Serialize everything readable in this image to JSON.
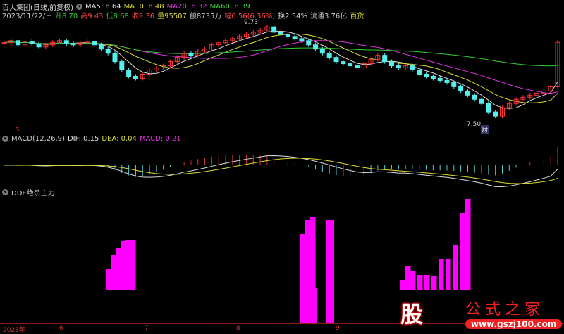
{
  "header": {
    "title": "百大集团(日线,前复权)",
    "ma5": "MA5: 8.64",
    "ma10": "MA10: 8.48",
    "ma20": "MA20: 8.32",
    "ma60": "MA60: 8.39",
    "date": "2023/11/22/三",
    "open": "开8.70",
    "high": "高9.43",
    "low": "低8.68",
    "close": "收9.36",
    "vol": "量95507",
    "amount": "额8735万",
    "change": "幅0.56(6.36%)",
    "turnover": "换2.54%",
    "float": "流通3.76亿",
    "industry": "百货"
  },
  "price_chart": {
    "high_label": "9.73",
    "low_label": "7.50",
    "fin_label": "财",
    "s_label": "S",
    "closes": [
      9.35,
      9.4,
      9.3,
      9.38,
      9.32,
      9.25,
      9.3,
      9.36,
      9.4,
      9.33,
      9.3,
      9.35,
      9.38,
      9.3,
      9.2,
      9.1,
      8.9,
      8.7,
      8.55,
      8.5,
      8.6,
      8.7,
      8.75,
      8.8,
      8.9,
      9.0,
      9.1,
      9.05,
      9.15,
      9.2,
      9.3,
      9.35,
      9.4,
      9.45,
      9.5,
      9.55,
      9.6,
      9.65,
      9.73,
      9.6,
      9.55,
      9.5,
      9.45,
      9.4,
      9.3,
      9.2,
      9.1,
      9.0,
      8.9,
      8.85,
      8.8,
      8.75,
      8.85,
      8.95,
      9.05,
      8.9,
      8.8,
      8.75,
      8.8,
      8.7,
      8.6,
      8.55,
      8.5,
      8.45,
      8.4,
      8.3,
      8.2,
      8.1,
      8.0,
      7.9,
      7.7,
      7.6,
      7.8,
      7.9,
      8.0,
      8.05,
      8.1,
      8.15,
      8.2,
      8.3,
      9.36
    ],
    "price_range": [
      7.3,
      9.9
    ]
  },
  "macd": {
    "title": "MACD(12,26,9)",
    "dif": "DIF: 0.15",
    "dea": "DEA: 0.04",
    "macd": "MACD: 0.21"
  },
  "dde": {
    "title": "DDE绝杀主力",
    "bars": [
      [
        150,
        30
      ],
      [
        157,
        50
      ],
      [
        164,
        60
      ],
      [
        171,
        70
      ],
      [
        178,
        72
      ],
      [
        185,
        72
      ],
      [
        426,
        80
      ],
      [
        433,
        100
      ],
      [
        440,
        105
      ],
      [
        463,
        100
      ],
      [
        568,
        15
      ],
      [
        575,
        35
      ],
      [
        582,
        28
      ],
      [
        592,
        22
      ],
      [
        602,
        22
      ],
      [
        612,
        20
      ],
      [
        622,
        45
      ],
      [
        632,
        45
      ],
      [
        642,
        65
      ],
      [
        652,
        110
      ],
      [
        660,
        130
      ]
    ]
  },
  "axis": {
    "labels": [
      "2023年",
      "6",
      "7",
      "8",
      "9"
    ]
  },
  "watermark": {
    "char": "股",
    "name": "公式之家",
    "url": "www.gszj100.com"
  }
}
